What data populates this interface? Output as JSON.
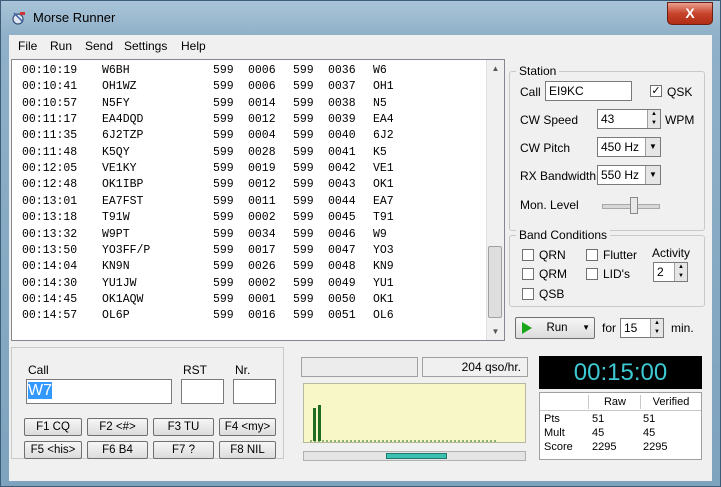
{
  "window": {
    "title": "Morse Runner",
    "close_label": "X"
  },
  "menu": [
    "File",
    "Run",
    "Send",
    "Settings",
    "Help"
  ],
  "log": [
    [
      "00:10:19",
      "W6BH",
      "599",
      "0006",
      "599",
      "0036",
      "W6"
    ],
    [
      "00:10:41",
      "OH1WZ",
      "599",
      "0006",
      "599",
      "0037",
      "OH1"
    ],
    [
      "00:10:57",
      "N5FY",
      "599",
      "0014",
      "599",
      "0038",
      "N5"
    ],
    [
      "00:11:17",
      "EA4DQD",
      "599",
      "0012",
      "599",
      "0039",
      "EA4"
    ],
    [
      "00:11:35",
      "6J2TZP",
      "599",
      "0004",
      "599",
      "0040",
      "6J2"
    ],
    [
      "00:11:48",
      "K5QY",
      "599",
      "0028",
      "599",
      "0041",
      "K5"
    ],
    [
      "00:12:05",
      "VE1KY",
      "599",
      "0019",
      "599",
      "0042",
      "VE1"
    ],
    [
      "00:12:48",
      "OK1IBP",
      "599",
      "0012",
      "599",
      "0043",
      "OK1"
    ],
    [
      "00:13:01",
      "EA7FST",
      "599",
      "0011",
      "599",
      "0044",
      "EA7"
    ],
    [
      "00:13:18",
      "T91W",
      "599",
      "0002",
      "599",
      "0045",
      "T91"
    ],
    [
      "00:13:32",
      "W9PT",
      "599",
      "0034",
      "599",
      "0046",
      "W9"
    ],
    [
      "00:13:50",
      "YO3FF/P",
      "599",
      "0017",
      "599",
      "0047",
      "YO3"
    ],
    [
      "00:14:04",
      "KN9N",
      "599",
      "0026",
      "599",
      "0048",
      "KN9"
    ],
    [
      "00:14:30",
      "YU1JW",
      "599",
      "0002",
      "599",
      "0049",
      "YU1"
    ],
    [
      "00:14:45",
      "OK1AQW",
      "599",
      "0001",
      "599",
      "0050",
      "OK1"
    ],
    [
      "00:14:57",
      "OL6P",
      "599",
      "0016",
      "599",
      "0051",
      "OL6"
    ]
  ],
  "station": {
    "title": "Station",
    "call_label": "Call",
    "call_value": "EI9KC",
    "qsk_label": "QSK",
    "qsk_checked": true,
    "cw_speed_label": "CW Speed",
    "cw_speed_value": "43",
    "wpm_label": "WPM",
    "cw_pitch_label": "CW Pitch",
    "cw_pitch_value": "450 Hz",
    "rx_bw_label": "RX Bandwidth",
    "rx_bw_value": "550 Hz",
    "mon_level_label": "Mon. Level",
    "mon_level_fraction": 0.55
  },
  "band": {
    "title": "Band Conditions",
    "qrn": "QRN",
    "flutter": "Flutter",
    "qrm": "QRM",
    "lids": "LID's",
    "qsb": "QSB",
    "activity_label": "Activity",
    "activity_value": "2"
  },
  "run": {
    "run_label": "Run",
    "for_label": "for",
    "minutes_value": "15",
    "min_label": "min."
  },
  "entry": {
    "call_label": "Call",
    "call_value": "W7",
    "rst_label": "RST",
    "rst_value": "",
    "nr_label": "Nr.",
    "nr_value": ""
  },
  "fkeys": [
    "F1  CQ",
    "F2  <#>",
    "F3  TU",
    "F4  <my>",
    "F5  <his>",
    "F6  B4",
    "F7  ?",
    "F8  NIL"
  ],
  "rate": {
    "text": "204  qso/hr."
  },
  "timer": "00:15:00",
  "score": {
    "headers": [
      "Raw",
      "Verified"
    ],
    "rows": [
      {
        "label": "Pts",
        "raw": "51",
        "verified": "51"
      },
      {
        "label": "Mult",
        "raw": "45",
        "verified": "45"
      },
      {
        "label": "Score",
        "raw": "2295",
        "verified": "2295"
      }
    ]
  },
  "colors": {
    "timer_text": "#3cc9d3",
    "band_scope_bg": "#f7f7c8",
    "band_scope_signal": "#1f6d1f",
    "progress": "#3cc0b0"
  }
}
